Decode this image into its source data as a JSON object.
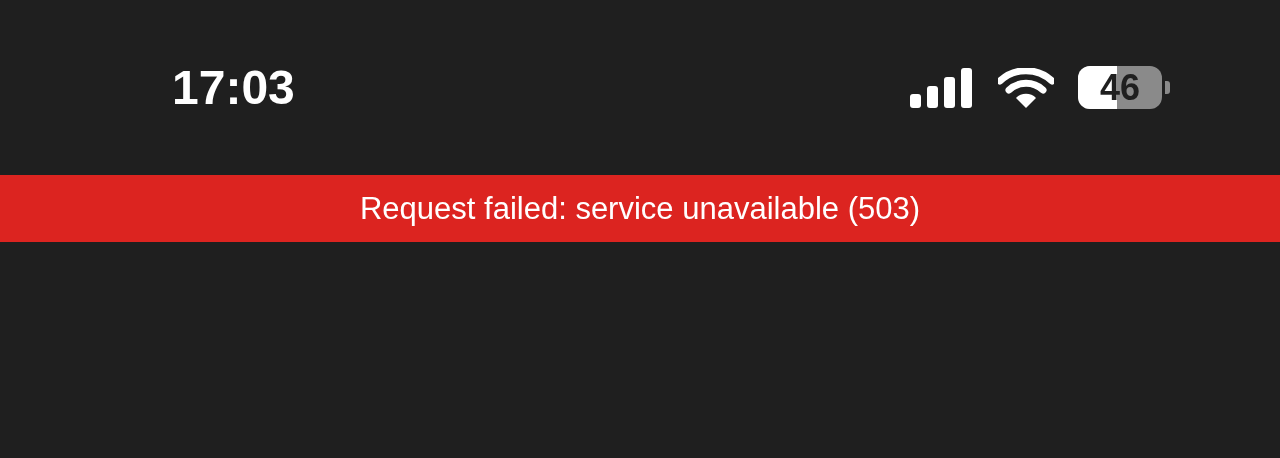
{
  "status_bar": {
    "time": "17:03",
    "battery": "46"
  },
  "error_banner": {
    "message": "Request failed: service unavailable (503)"
  }
}
